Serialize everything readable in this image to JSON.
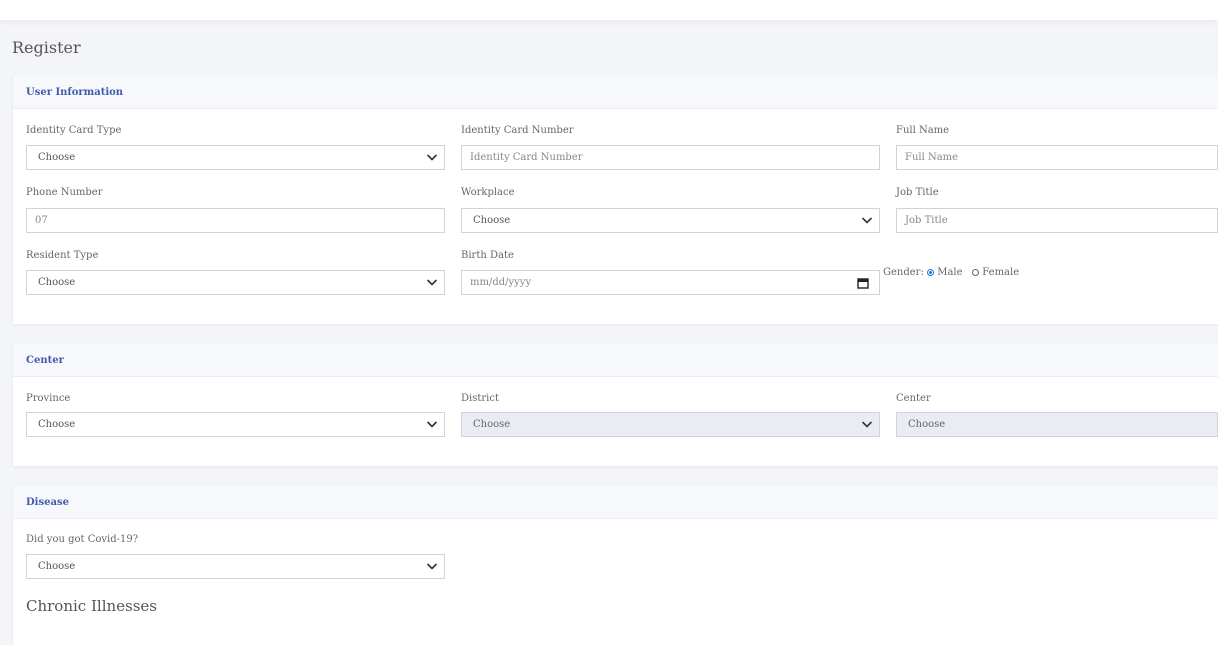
{
  "page": {
    "title": "Register"
  },
  "user_info": {
    "title": "User Information",
    "identity_card_type": {
      "label": "Identity Card Type",
      "value": "Choose"
    },
    "identity_card_number": {
      "label": "Identity Card Number",
      "placeholder": "Identity Card Number"
    },
    "full_name": {
      "label": "Full Name",
      "placeholder": "Full Name"
    },
    "phone_number": {
      "label": "Phone Number",
      "value": "07"
    },
    "workplace": {
      "label": "Workplace",
      "value": "Choose"
    },
    "job_title": {
      "label": "Job Title",
      "placeholder": "Job Title"
    },
    "resident_type": {
      "label": "Resident Type",
      "value": "Choose"
    },
    "birth_date": {
      "label": "Birth Date",
      "placeholder": "mm/dd/yyyy"
    },
    "gender": {
      "label": "Gender:",
      "options": [
        "Male",
        "Female"
      ],
      "selected": "Male"
    }
  },
  "center": {
    "title": "Center",
    "province": {
      "label": "Province",
      "value": "Choose"
    },
    "district": {
      "label": "District",
      "value": "Choose"
    },
    "center": {
      "label": "Center",
      "value": "Choose"
    }
  },
  "disease": {
    "title": "Disease",
    "covid": {
      "label": "Did you got Covid-19?",
      "value": "Choose"
    },
    "chronic_title": "Chronic Illnesses"
  }
}
